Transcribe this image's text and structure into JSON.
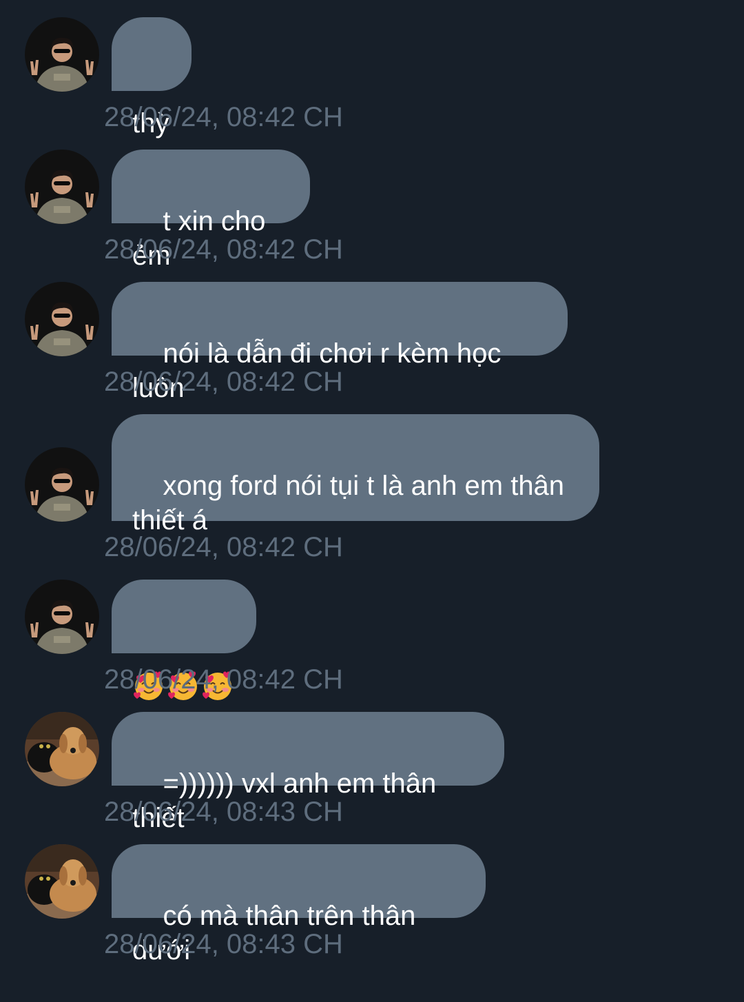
{
  "messages": [
    {
      "sender": "avatar-person",
      "text": "thỳ",
      "time": "28/06/24, 08:42 CH"
    },
    {
      "sender": "avatar-person",
      "text": "t xin cho ẻm",
      "time": "28/06/24, 08:42 CH"
    },
    {
      "sender": "avatar-person",
      "text": "nói là dẫn đi chơi r kèm học luôn",
      "time": "28/06/24, 08:42 CH"
    },
    {
      "sender": "avatar-person",
      "text": "xong ford nói tụi t là anh em thân\nthiết á",
      "time": "28/06/24, 08:42 CH"
    },
    {
      "sender": "avatar-person",
      "text": "🥰🥰🥰",
      "time": "28/06/24, 08:42 CH"
    },
    {
      "sender": "avatar-dog",
      "text": "=)))))) vxl anh em thân thiết",
      "time": "28/06/24, 08:43 CH"
    },
    {
      "sender": "avatar-dog",
      "text": "có mà thân trên thân dưới",
      "time": "28/06/24, 08:43 CH"
    }
  ],
  "colors": {
    "background": "#171f29",
    "bubble": "#617181",
    "bubble_text": "#ffffff",
    "timestamp": "#5e6d7d"
  },
  "icons": {
    "emoji": "smiling-face-with-hearts"
  }
}
